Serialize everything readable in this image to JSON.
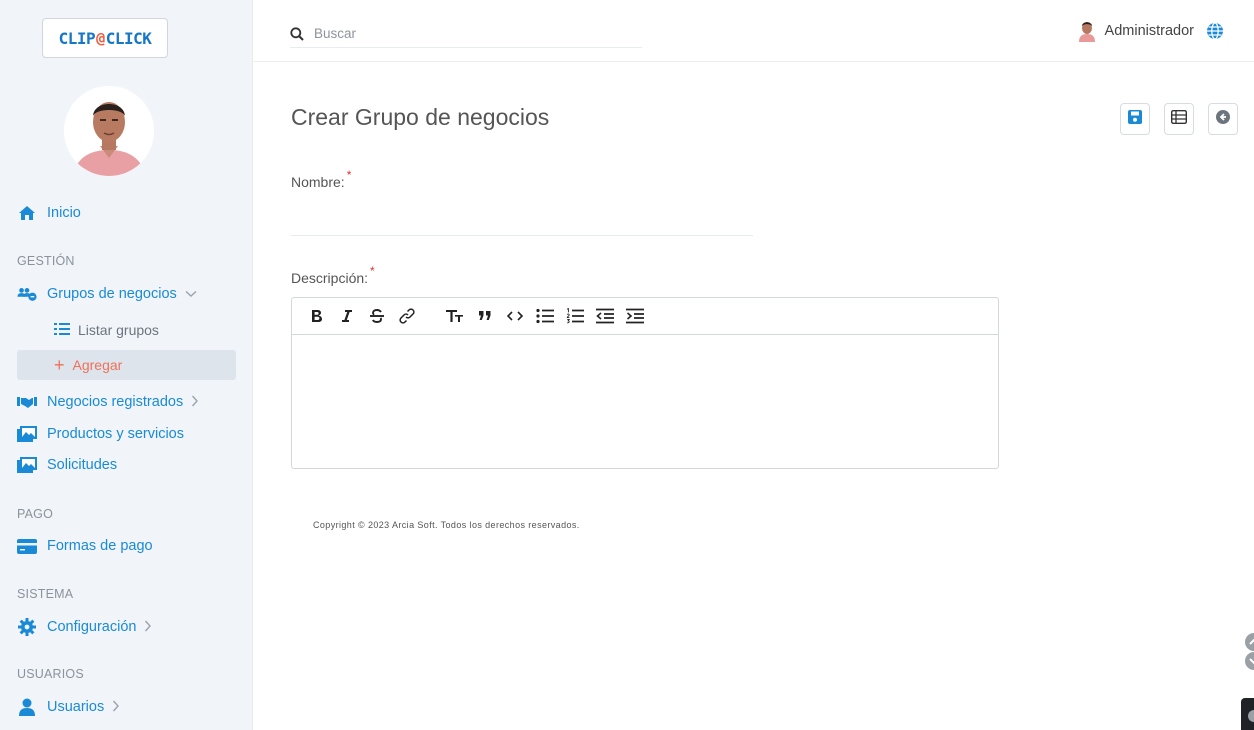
{
  "brand": {
    "logo_left": "CLIP",
    "logo_clip": "@",
    "logo_right": "CLICK"
  },
  "sidebar": {
    "home": "Inicio",
    "sections": {
      "gestion": "GESTIÓN",
      "pago": "PAGO",
      "sistema": "SISTEMA",
      "usuarios": "USUARIOS"
    },
    "grupos": "Grupos de negocios",
    "grupos_sub": {
      "listar": "Listar grupos",
      "agregar": "Agregar"
    },
    "negocios": "Negocios registrados",
    "productos": "Productos y servicios",
    "solicitudes": "Solicitudes",
    "formas_pago": "Formas de pago",
    "configuracion": "Configuración",
    "usuarios": "Usuarios"
  },
  "topbar": {
    "search_placeholder": "Buscar",
    "user_name": "Administrador"
  },
  "main": {
    "title": "Crear Grupo de negocios",
    "nombre_label": "Nombre:",
    "descripcion_label": "Descripción:",
    "required_mark": "*",
    "nombre_value": ""
  },
  "footer": {
    "copyright": "Copyright © 2023 Arcia Soft. Todos los derechos reservados."
  },
  "colors": {
    "accent": "#1a8ad6",
    "active": "#f0715a",
    "sidebar_bg": "#f1f5f9",
    "required": "#e0322d"
  },
  "icons": {
    "actions": [
      "save-icon",
      "list-icon",
      "back-icon"
    ],
    "editor_toolbar": [
      "bold-icon",
      "italic-icon",
      "strikethrough-icon",
      "link-icon",
      "heading-icon",
      "quote-icon",
      "code-icon",
      "bullet-list-icon",
      "numbered-list-icon",
      "outdent-icon",
      "indent-icon"
    ]
  }
}
